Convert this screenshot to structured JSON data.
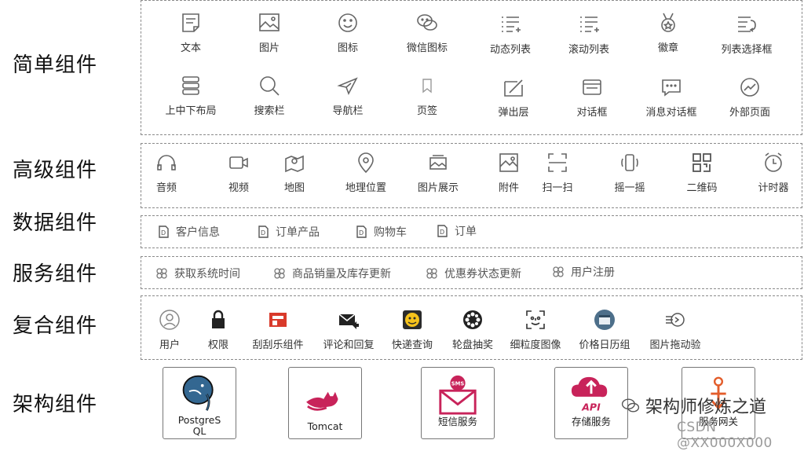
{
  "categories": {
    "simple": "简单组件",
    "advanced": "高级组件",
    "data": "数据组件",
    "service": "服务组件",
    "composite": "复合组件",
    "architecture": "架构组件"
  },
  "simple_row1": [
    "文本",
    "图片",
    "图标",
    "微信图标",
    "动态列表",
    "滚动列表",
    "徽章",
    "列表选择框"
  ],
  "simple_row2": [
    "上中下布局",
    "搜索栏",
    "导航栏",
    "页签",
    "弹出层",
    "对话框",
    "消息对话框",
    "外部页面"
  ],
  "advanced": [
    "音频",
    "视频",
    "地图",
    "地理位置",
    "图片展示",
    "附件",
    "扫一扫",
    "摇一摇",
    "二维码",
    "计时器"
  ],
  "data_items": [
    "客户信息",
    "订单产品",
    "购物车",
    "订单"
  ],
  "service_items": [
    "获取系统时间",
    "商品销量及库存更新",
    "优惠券状态更新",
    "用户注册"
  ],
  "composite": [
    "用户",
    "权限",
    "刮刮乐组件",
    "评论和回复",
    "快递查询",
    "轮盘抽奖",
    "细粒度图像",
    "价格日历组",
    "图片拖动验"
  ],
  "architecture": [
    "PostgreS QL",
    "Tomcat",
    "短信服务",
    "存储服务",
    "服务网关"
  ],
  "sms_label": "SMS",
  "api_label": "API",
  "watermark": {
    "brand": "架构师修炼之道",
    "csdn": "CSDN @XX000X000"
  },
  "colors": {
    "icon_gray": "#666666",
    "dashed_border": "#8a8a8a",
    "brand_red": "#c8235a"
  }
}
